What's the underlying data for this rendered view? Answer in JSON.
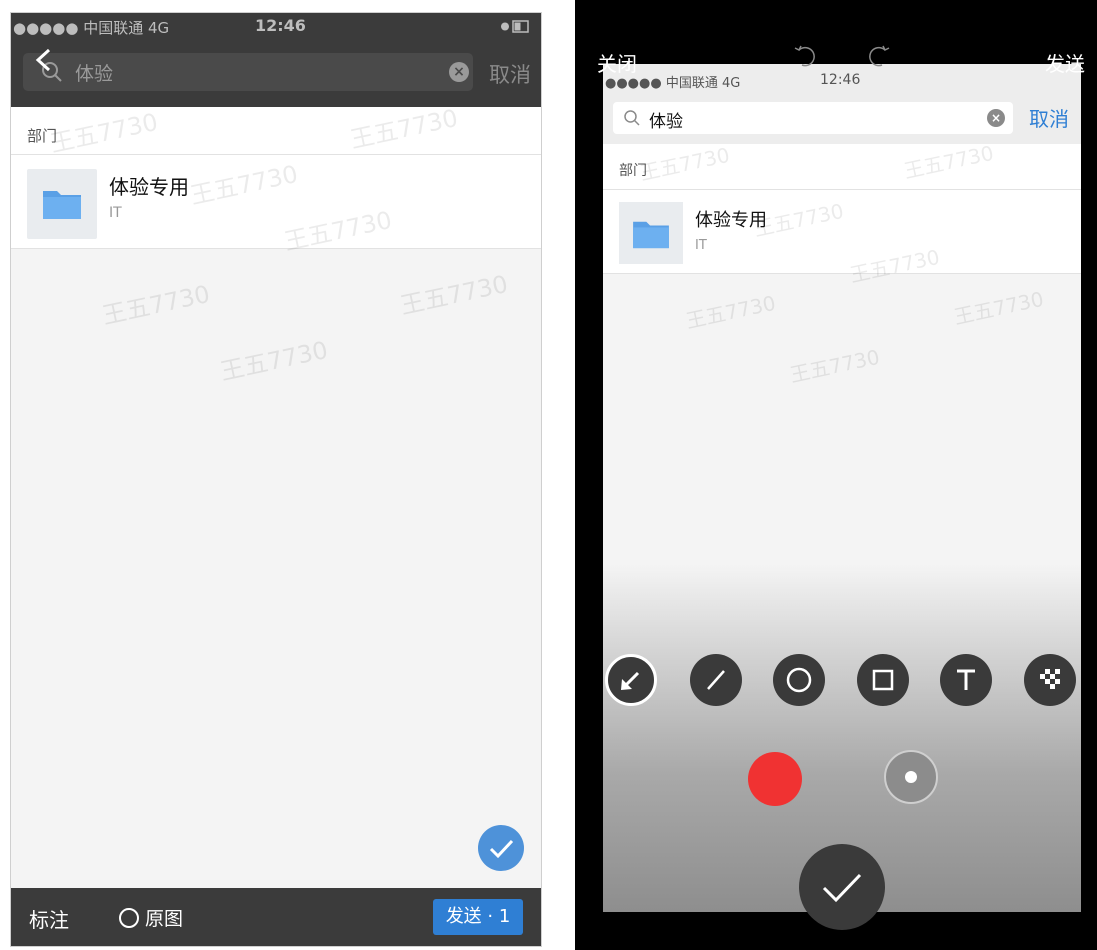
{
  "left": {
    "status": {
      "carrier": "●●●●● 中国联通 4G",
      "time": "12:46"
    },
    "search": {
      "query": "体验",
      "cancel": "取消"
    },
    "section_label": "部门",
    "result": {
      "name": "体验专用",
      "sub": "IT"
    },
    "bottom": {
      "mark": "标注",
      "original": "原图",
      "send": "发送 · 1"
    },
    "watermark": "王五7730"
  },
  "right": {
    "topbar": {
      "close": "关闭",
      "send": "发送"
    },
    "status": {
      "carrier": "●●●●● 中国联通 4G",
      "time": "12:46"
    },
    "search": {
      "query": "体验",
      "cancel": "取消"
    },
    "section_label": "部门",
    "result": {
      "name": "体验专用",
      "sub": "IT"
    },
    "tools": [
      "arrow-icon",
      "line-icon",
      "circle-icon",
      "rectangle-icon",
      "text-icon",
      "mosaic-icon"
    ],
    "selected_color": "#f03232"
  },
  "colors": {
    "accent": "#2f7fd4",
    "dark_bar": "#3b3b3b"
  }
}
